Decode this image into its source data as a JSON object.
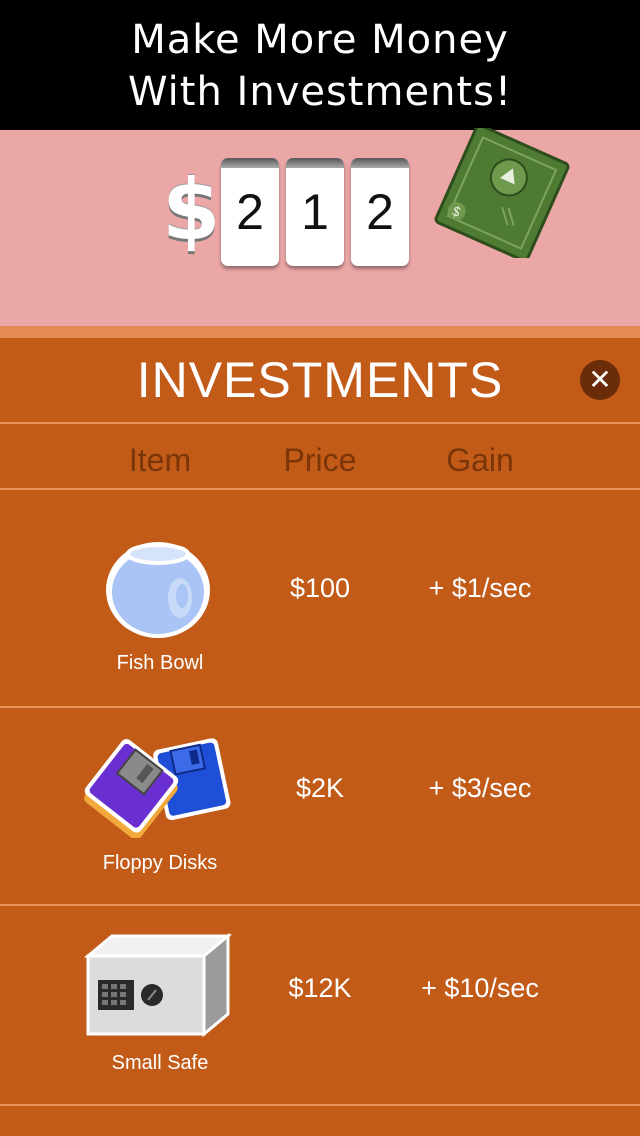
{
  "banner": {
    "line1": "Make More Money",
    "line2": "With Investments!"
  },
  "counter": {
    "currency_symbol": "$",
    "digits": [
      "2",
      "1",
      "2"
    ]
  },
  "panel": {
    "title": "INVESTMENTS",
    "close_icon": "close-icon"
  },
  "columns": {
    "item": "Item",
    "price": "Price",
    "gain": "Gain"
  },
  "investments": [
    {
      "name": "Fish Bowl",
      "price": "$100",
      "gain": "+ $1/sec",
      "icon": "fish-bowl-icon"
    },
    {
      "name": "Floppy Disks",
      "price": "$2K",
      "gain": "+ $3/sec",
      "icon": "floppy-disks-icon"
    },
    {
      "name": "Small Safe",
      "price": "$12K",
      "gain": "+ $10/sec",
      "icon": "safe-icon"
    }
  ],
  "colors": {
    "banner": "#000000",
    "top_bg": "#eba6a6",
    "panel_bg": "#c25b18",
    "header_text": "#7a3508",
    "close_bg": "#6b2c0a"
  }
}
